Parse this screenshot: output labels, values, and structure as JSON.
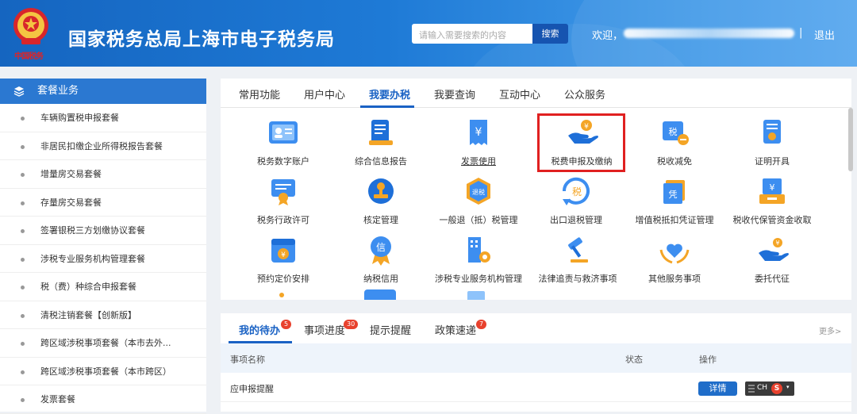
{
  "header": {
    "emblem_text": "中国税务",
    "title": "国家税务总局上海市电子税务局",
    "search_placeholder": "请输入需要搜索的内容",
    "search_button": "搜索",
    "welcome": "欢迎，",
    "separator": "|",
    "logout": "退出"
  },
  "sidebar": {
    "title": "套餐业务",
    "items": [
      "车辆购置税申报套餐",
      "非居民扣缴企业所得税报告套餐",
      "增量房交易套餐",
      "存量房交易套餐",
      "签署银税三方划缴协议套餐",
      "涉税专业服务机构管理套餐",
      "税（费）种综合申报套餐",
      "清税注销套餐【创新版】",
      "跨区域涉税事项套餐（本市去外...",
      "跨区域涉税事项套餐（本市跨区）",
      "发票套餐"
    ]
  },
  "tabs": [
    "常用功能",
    "用户中心",
    "我要办税",
    "我要查询",
    "互动中心",
    "公众服务"
  ],
  "active_tab": "我要办税",
  "grid": [
    {
      "label": "税务数字账户",
      "icon": "id-card-icon"
    },
    {
      "label": "综合信息报告",
      "icon": "document-report-icon"
    },
    {
      "label": "发票使用",
      "icon": "invoice-icon"
    },
    {
      "label": "税费申报及缴纳",
      "icon": "hand-coin-icon"
    },
    {
      "label": "税收减免",
      "icon": "tax-reduction-icon"
    },
    {
      "label": "证明开具",
      "icon": "certificate-icon"
    },
    {
      "label": "税务行政许可",
      "icon": "license-icon"
    },
    {
      "label": "核定管理",
      "icon": "stamp-icon"
    },
    {
      "label": "一般退（抵）税管理",
      "icon": "refund-badge-icon"
    },
    {
      "label": "出口退税管理",
      "icon": "export-refund-icon"
    },
    {
      "label": "增值税抵扣凭证管理",
      "icon": "voucher-icon"
    },
    {
      "label": "税收代保管资金收取",
      "icon": "fund-box-icon"
    },
    {
      "label": "预约定价安排",
      "icon": "calendar-yuan-icon"
    },
    {
      "label": "纳税信用",
      "icon": "credit-medal-icon"
    },
    {
      "label": "涉税专业服务机构管理",
      "icon": "building-gear-icon"
    },
    {
      "label": "法律追责与救济事项",
      "icon": "gavel-icon"
    },
    {
      "label": "其他服务事项",
      "icon": "heart-hands-icon"
    },
    {
      "label": "委托代征",
      "icon": "hand-coin-small-icon"
    }
  ],
  "bottom": {
    "tabs": [
      "我的待办",
      "事项进度",
      "提示提醒",
      "政策速递"
    ],
    "badges": [
      "5",
      "30",
      "",
      "7"
    ],
    "more": "更多>",
    "columns": [
      "事项名称",
      "状态",
      "操作"
    ],
    "row_name": "应申报提醒",
    "detail_button": "详情",
    "ime_text": "CH"
  },
  "colors": {
    "header": "#1e7ad6",
    "accent": "#1a62c4",
    "highlight": "#e02020"
  }
}
